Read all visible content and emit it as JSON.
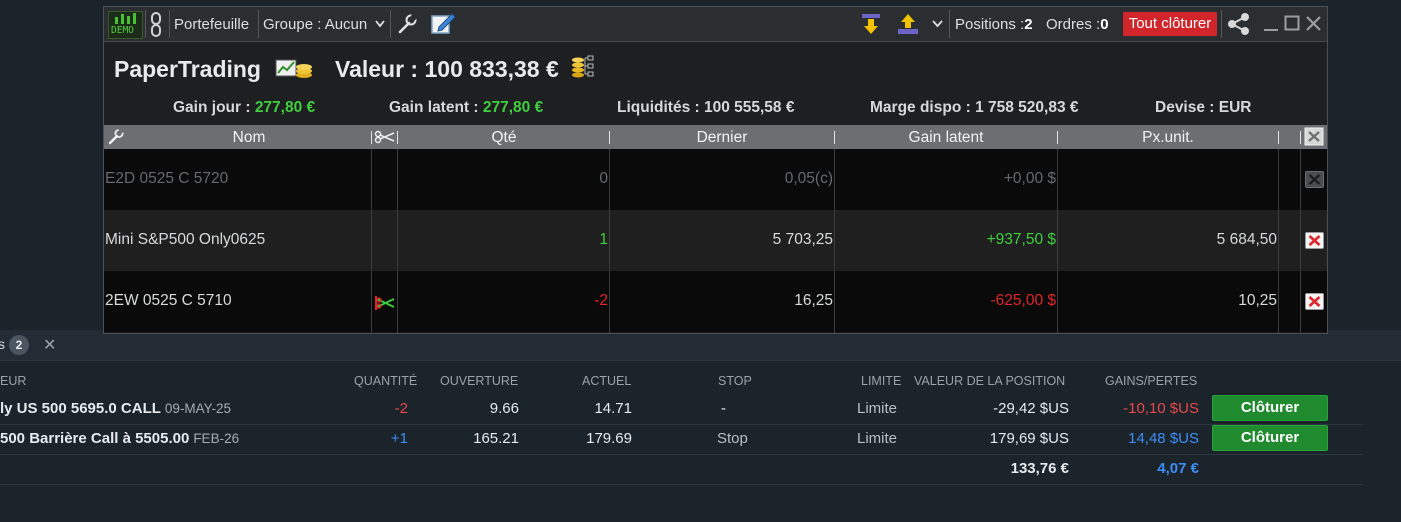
{
  "toolbar": {
    "demo_label": "DEMO",
    "portfolio_label": "Portefeuille",
    "group_label": "Groupe : Aucun",
    "positions_label": "Positions :",
    "positions_count": "2",
    "orders_label": "Ordres :",
    "orders_count": "0",
    "close_all_label": "Tout clôturer"
  },
  "summary": {
    "account_name": "PaperTrading",
    "value_text": "Valeur : 100 833,38 €",
    "day_gain_label": "Gain jour :",
    "day_gain_value": "277,80 €",
    "latent_gain_label": "Gain latent :",
    "latent_gain_value": "277,80 €",
    "liquidity_text": "Liquidités : 100 555,58 €",
    "margin_text": "Marge dispo : 1 758 520,83 €",
    "currency_text": "Devise : EUR"
  },
  "table": {
    "headers": {
      "name": "Nom",
      "qty": "Qté",
      "last": "Dernier",
      "latent_gain": "Gain latent",
      "unit_price": "Px.unit."
    },
    "rows": [
      {
        "name": "E2D 0525 C 5720",
        "qty": "0",
        "last": "0,05(c)",
        "gain": "+0,00 $",
        "unit": ""
      },
      {
        "name": "Mini S&P500 Only0625",
        "qty": "1",
        "last": "5 703,25",
        "gain": "+937,50 $",
        "unit": "5 684,50"
      },
      {
        "name": "2EW 0525 C 5710",
        "qty": "-2",
        "last": "16,25",
        "gain": "-625,00 $",
        "unit": "10,25"
      }
    ]
  },
  "bottom": {
    "tab_label": "s",
    "tab_count": "2",
    "headers": {
      "instrument": "EUR",
      "quantity": "QUANTITÉ",
      "opening": "OUVERTURE",
      "current": "ACTUEL",
      "stop": "STOP",
      "limit": "LIMITE",
      "position_value": "VALEUR DE LA POSITION",
      "pnl": "GAINS/PERTES"
    },
    "rows": [
      {
        "name": "ly US 500 5695.0 CALL",
        "date": "09-MAY-25",
        "quantity": "-2",
        "opening": "9.66",
        "current": "14.71",
        "stop": "-",
        "limit": "Limite",
        "value": "-29,42 $US",
        "pnl": "-10,10 $US",
        "button": "Clôturer"
      },
      {
        "name": "500 Barrière Call à 5505.00",
        "date": "FEB-26",
        "quantity": "+1",
        "opening": "165.21",
        "current": "179.69",
        "stop": "Stop",
        "limit": "Limite",
        "value": "179,69 $US",
        "pnl": "14,48 $US",
        "button": "Clôturer"
      }
    ],
    "totals": {
      "value": "133,76 €",
      "pnl": "4,07 €"
    }
  }
}
